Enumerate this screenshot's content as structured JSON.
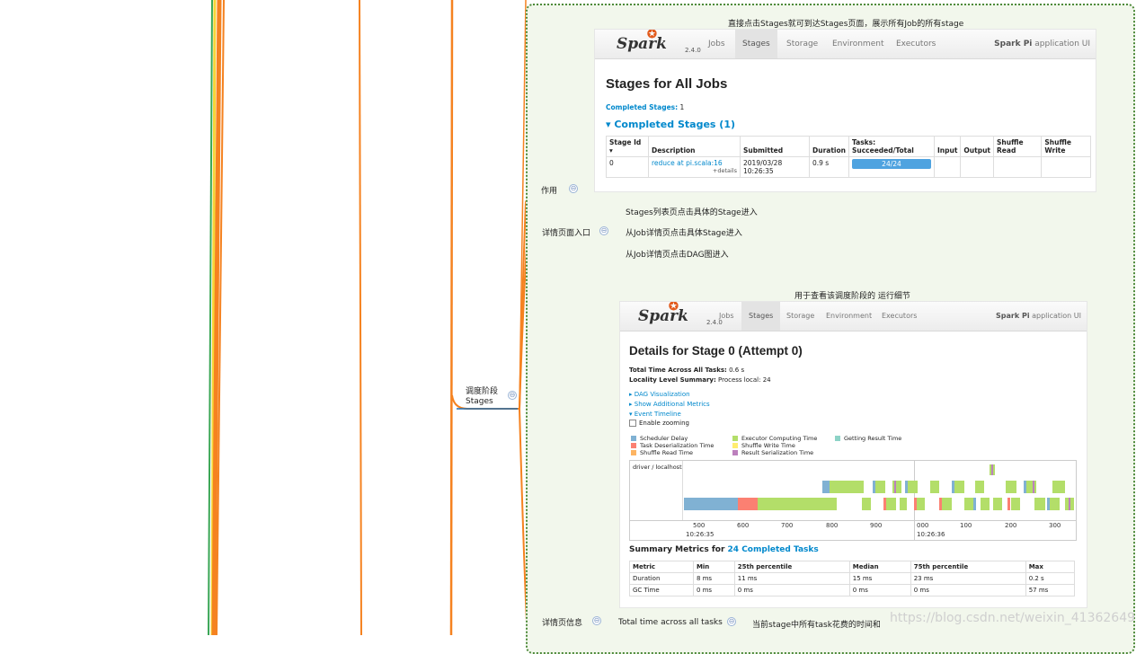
{
  "colors": {
    "wire": "#f58220",
    "wire_blue": "#1f6fb5",
    "group_border": "#4d8a3a",
    "group_fill": "#f2f7ec",
    "accent_link": "#0088cc",
    "progress": "#4fa3e0"
  },
  "mindmap": {
    "root_node": "调度阶段\nStages",
    "root_line1": "调度阶段",
    "root_line2": "Stages",
    "node_purpose": "作用",
    "node_entry": "详情页面入口",
    "node_detail": "详情页信息",
    "entry_items": [
      "Stages列表页点击具体的Stage进入",
      "从Job详情页点击具体Stage进入",
      "从Job详情页点击DAG图进入"
    ],
    "caption_top": "直接点击Stages就可到达Stages页面，展示所有Job的所有stage",
    "caption_mid": "用于查看该调度阶段的 运行细节",
    "detail_item_1": "Total time across all tasks",
    "detail_item_1_desc": "当前stage中所有task花费的时间和",
    "collapse_glyph": "⊖",
    "watermark": "https://blog.csdn.net/weixin_41362649"
  },
  "shot1": {
    "logo_text": "Spark",
    "logo_version": "2.4.0",
    "tabs": [
      "Jobs",
      "Stages",
      "Storage",
      "Environment",
      "Executors"
    ],
    "active_tab": "Stages",
    "app_bold": "Spark Pi",
    "app_rest": " application UI",
    "title": "Stages for All Jobs",
    "completed_label": "Completed Stages:",
    "completed_value": " 1",
    "section_title": "▾ Completed Stages (1)",
    "columns": [
      "Stage Id ▾",
      "Description",
      "Submitted",
      "Duration",
      "Tasks: Succeeded/Total",
      "Input",
      "Output",
      "Shuffle Read",
      "Shuffle Write"
    ],
    "row": {
      "stage_id": "0",
      "description": "reduce at pi.scala:16",
      "details": "+details",
      "submitted": "2019/03/28 10:26:35",
      "duration": "0.9 s",
      "tasks": "24/24",
      "tasks_fraction": 1.0
    }
  },
  "shot2": {
    "logo_text": "Spark",
    "logo_version": "2.4.0",
    "tabs": [
      "Jobs",
      "Stages",
      "Storage",
      "Environment",
      "Executors"
    ],
    "active_tab": "Stages",
    "app_bold": "Spark Pi",
    "app_rest": " application UI",
    "title": "Details for Stage 0 (Attempt 0)",
    "total_time_label": "Total Time Across All Tasks:",
    "total_time_value": " 0.6 s",
    "locality_label": "Locality Level Summary:",
    "locality_value": " Process local: 24",
    "links": [
      "DAG Visualization",
      "Show Additional Metrics",
      "Event Timeline"
    ],
    "enable_zooming": "Enable zooming",
    "legend": [
      {
        "label": "Scheduler Delay",
        "color": "#80b1d3"
      },
      {
        "label": "Task Deserialization Time",
        "color": "#fb8072"
      },
      {
        "label": "Shuffle Read Time",
        "color": "#fdb462"
      },
      {
        "label": "Executor Computing Time",
        "color": "#b3de69"
      },
      {
        "label": "Shuffle Write Time",
        "color": "#ffed6f"
      },
      {
        "label": "Result Serialization Time",
        "color": "#bc80bd"
      },
      {
        "label": "Getting Result Time",
        "color": "#8dd3c7"
      }
    ],
    "timeline_row_label": "driver / localhost",
    "axis_ticks": [
      "500",
      "600",
      "700",
      "800",
      "900",
      "000",
      "100",
      "200",
      "300"
    ],
    "axis_time_left": "10:26:35",
    "axis_time_right": "10:26:36",
    "summary_title": "Summary Metrics for ",
    "summary_link": "24 Completed Tasks",
    "summary_columns": [
      "Metric",
      "Min",
      "25th percentile",
      "Median",
      "75th percentile",
      "Max"
    ],
    "summary_rows": [
      [
        "Duration",
        "8 ms",
        "11 ms",
        "15 ms",
        "23 ms",
        "0.2 s"
      ],
      [
        "GC Time",
        "0 ms",
        "0 ms",
        "0 ms",
        "0 ms",
        "57 ms"
      ]
    ]
  }
}
